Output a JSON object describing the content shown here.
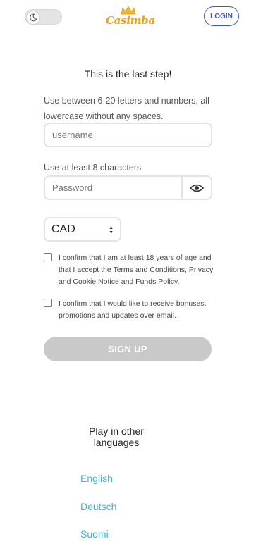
{
  "header": {
    "logo_text": "Casimba",
    "login_label": "LOGIN",
    "theme_toggle_icon": "moon-icon"
  },
  "form": {
    "title": "This is the last step!",
    "username_hint": "Use between 6-20 letters and numbers, all lowercase without any spaces.",
    "username_placeholder": "username",
    "password_hint": "Use at least 8 characters",
    "password_placeholder": "Password",
    "show_password_icon": "eye-icon",
    "currency_value": "CAD",
    "age_confirm": {
      "prefix": "I confirm that I am at least 18 years of age and that I accept the ",
      "terms_link": "Terms and Conditions",
      "sep": ", ",
      "privacy_link": "Privacy and Cookie Notice",
      "and": " and ",
      "funds_link": "Funds Policy",
      "suffix": "."
    },
    "marketing_confirm": "I confirm that I would like to receive bonuses, promotions and updates over email.",
    "signup_label": "SIGN UP"
  },
  "languages": {
    "title": "Play in other languages",
    "items": [
      "English",
      "Deutsch",
      "Suomi"
    ]
  },
  "colors": {
    "accent": "#3f5cc4",
    "logo": "#e9a21f",
    "link": "#3fb1d3",
    "button_disabled": "#c9c9c9"
  }
}
